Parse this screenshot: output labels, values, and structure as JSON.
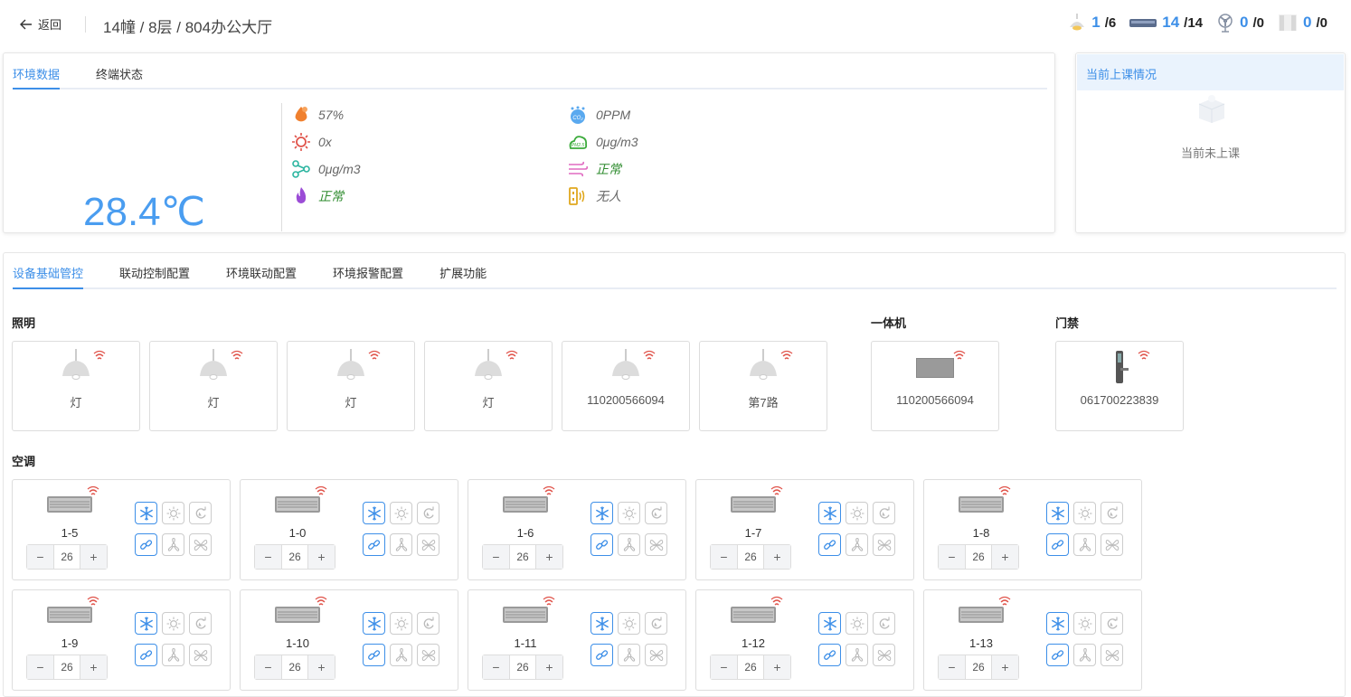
{
  "header": {
    "back_label": "返回",
    "breadcrumb": "14幢 / 8层 / 804办公大厅",
    "stats": [
      {
        "icon": "lamp-icon",
        "active": "1",
        "total": "/6"
      },
      {
        "icon": "terminal-icon",
        "active": "14",
        "total": "/14"
      },
      {
        "icon": "fan-icon",
        "active": "0",
        "total": "/0"
      },
      {
        "icon": "curtain-icon",
        "active": "0",
        "total": "/0"
      }
    ]
  },
  "env_panel": {
    "tabs": [
      "环境数据",
      "终端状态"
    ],
    "temperature": "28.4℃",
    "readings_left": [
      {
        "icon": "humidity-icon",
        "value": "57%"
      },
      {
        "icon": "light-intensity-icon",
        "value": "0x"
      },
      {
        "icon": "molecule-icon",
        "value": "0μg/m3"
      },
      {
        "icon": "fire-icon",
        "value": "正常"
      }
    ],
    "readings_right": [
      {
        "icon": "co2-icon",
        "value": "0PPM"
      },
      {
        "icon": "pm25-icon",
        "value": "0μg/m3"
      },
      {
        "icon": "smoke-icon",
        "value": "正常"
      },
      {
        "icon": "presence-sensor-icon",
        "value": "无人"
      }
    ]
  },
  "class_panel": {
    "title": "当前上课情况",
    "empty_text": "当前未上课"
  },
  "device_panel": {
    "tabs": [
      "设备基础管控",
      "联动控制配置",
      "环境联动配置",
      "环境报警配置",
      "扩展功能"
    ],
    "lighting_title": "照明",
    "lights": [
      "灯",
      "灯",
      "灯",
      "灯",
      "110200566094",
      "第7路"
    ],
    "terminal_title": "一体机",
    "terminal_label": "110200566094",
    "door_title": "门禁",
    "door_label": "061700223839",
    "ac_title": "空调",
    "ac_units": [
      {
        "name": "1-5",
        "temp": "26"
      },
      {
        "name": "1-0",
        "temp": "26"
      },
      {
        "name": "1-6",
        "temp": "26"
      },
      {
        "name": "1-7",
        "temp": "26"
      },
      {
        "name": "1-8",
        "temp": "26"
      },
      {
        "name": "1-9",
        "temp": "26"
      },
      {
        "name": "1-10",
        "temp": "26"
      },
      {
        "name": "1-11",
        "temp": "26"
      },
      {
        "name": "1-12",
        "temp": "26"
      },
      {
        "name": "1-13",
        "temp": "26"
      }
    ],
    "stepper_minus": "−",
    "stepper_plus": "+"
  },
  "colors": {
    "accent": "#3d8fe8",
    "temperature": "#4a9df0",
    "normal": "#2e8b2e",
    "wifi": "#e0534a"
  }
}
